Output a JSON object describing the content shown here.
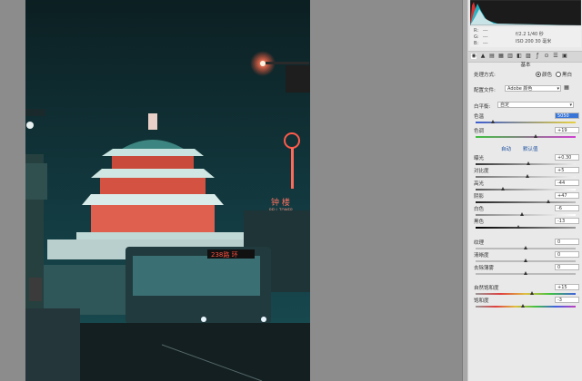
{
  "readout": {
    "r_label": "R:",
    "r_value": "---",
    "g_label": "G:",
    "g_value": "---",
    "b_label": "B:",
    "b_value": "---",
    "exposure_info": "f/2.2  1/40 秒",
    "iso_info": "ISO 200  30 毫米"
  },
  "toolbar": {
    "icons": [
      "aperture-icon",
      "mountain-icon",
      "tone-curve-icon",
      "detail-icon",
      "hsl-icon",
      "split-tone-icon",
      "lens-icon",
      "fx-icon",
      "camera-calibration-icon",
      "presets-icon",
      "snapshots-icon"
    ]
  },
  "basic": {
    "section_title": "基本",
    "treatment_label": "处理方式:",
    "treatment_color": "颜色",
    "treatment_bw": "黑白",
    "profile_label": "配置文件:",
    "profile_value": "Adobe 颜色",
    "wb_label": "白平衡:",
    "wb_value": "自定",
    "temp_label": "色温",
    "temp_value": "5050",
    "tint_label": "色调",
    "tint_value": "+19",
    "auto_label": "自动",
    "default_label": "默认值",
    "exposure_label": "曝光",
    "exposure_value": "+0.30",
    "contrast_label": "对比度",
    "contrast_value": "+5",
    "highlights_label": "高光",
    "highlights_value": "-44",
    "shadows_label": "阴影",
    "shadows_value": "+47",
    "whites_label": "白色",
    "whites_value": "-6",
    "blacks_label": "黑色",
    "blacks_value": "-13",
    "texture_label": "纹理",
    "texture_value": "0",
    "clarity_label": "清晰度",
    "clarity_value": "0",
    "dehaze_label": "去除薄雾",
    "dehaze_value": "0",
    "vibrance_label": "自然饱和度",
    "vibrance_value": "+15",
    "saturation_label": "饱和度",
    "saturation_value": "-3"
  },
  "photo": {
    "sign_text": "钟 楼",
    "sign_sub": "BELL TOWER",
    "bus_led": "238路 环"
  },
  "colors": {
    "panel_bg": "#e9e9e9",
    "canvas_bg": "#8c8c8c",
    "selection": "#3875d7",
    "sky": "#0e2a2e",
    "neon_red": "#ff5a4a",
    "teal": "#1d6f74"
  }
}
